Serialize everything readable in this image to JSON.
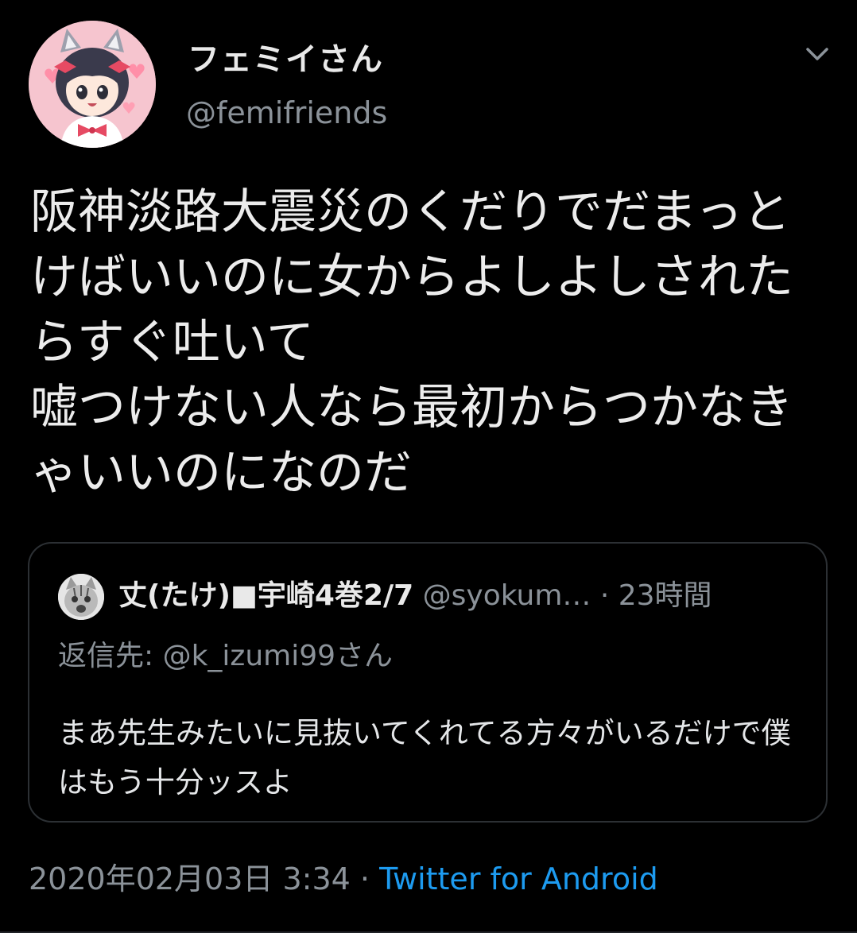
{
  "tweet": {
    "display_name": "フェミイさん",
    "handle": "@femifriends",
    "text": "阪神淡路大震災のくだりでだまっとけばいいのに女からよしよしされたらすぐ吐いて\n嘘つけない人なら最初からつかなきゃいいのになのだ"
  },
  "quote": {
    "display_name": "丈(たけ)■宇崎4巻2/7",
    "handle": "@syokum…",
    "dot": " · ",
    "time": "23時間",
    "reply_to": "返信先: @k_izumi99さん",
    "text": "まあ先生みたいに見抜いてくれてる方々がいるだけで僕はもう十分ッスよ"
  },
  "footer": {
    "timestamp": "2020年02月03日 3:34",
    "separator": " · ",
    "source": "Twitter for Android"
  },
  "colors": {
    "background": "#000000",
    "text": "#e7e9ea",
    "secondary": "#8b9299",
    "link": "#1d9bf0",
    "border": "#2c3034"
  },
  "icons": {
    "menu": "chevron-down-icon"
  }
}
